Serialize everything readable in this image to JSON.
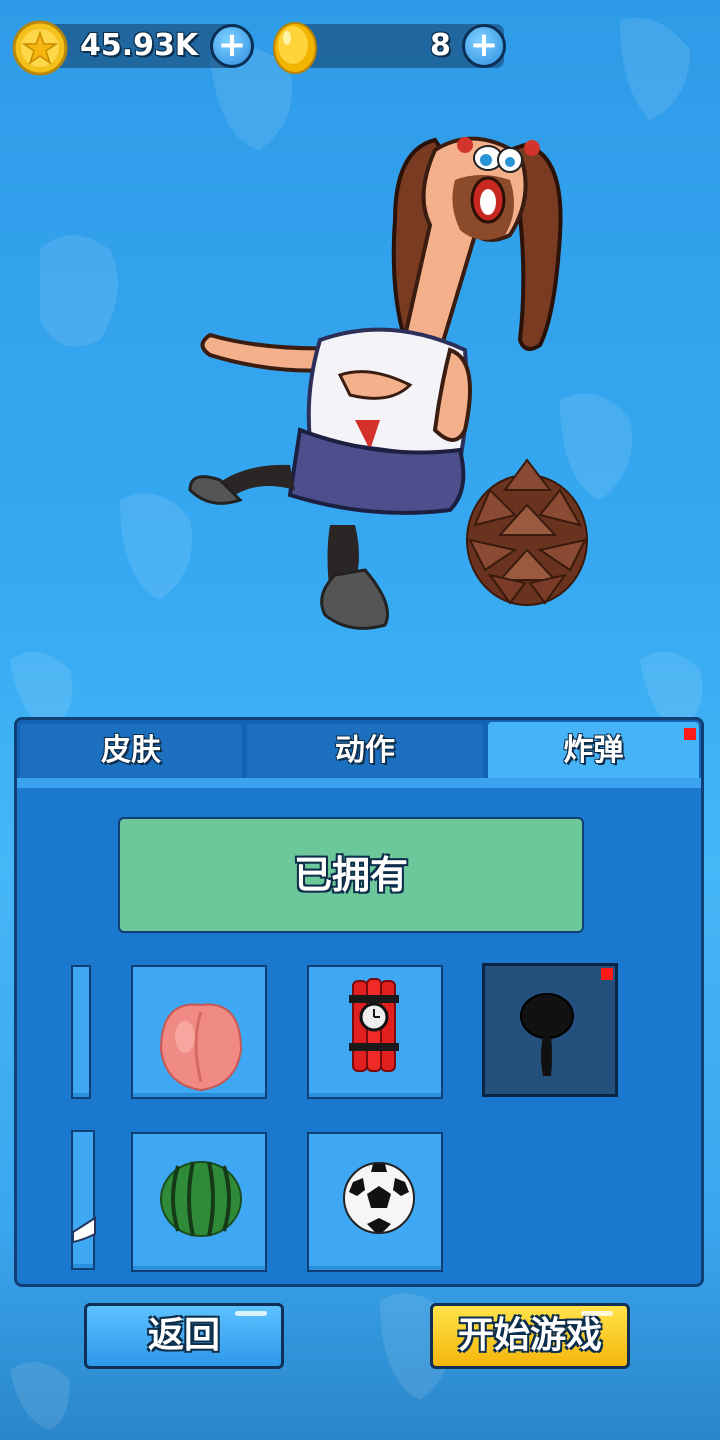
{
  "currency": {
    "stars": "45.93K",
    "coins": "8",
    "star_icon": "star-coin-icon",
    "coin_icon": "gold-egg-icon",
    "add_icon": "plus-icon"
  },
  "tabs": [
    {
      "label": "皮肤",
      "active": false
    },
    {
      "label": "动作",
      "active": false
    },
    {
      "label": "炸弹",
      "active": true,
      "badge": true
    }
  ],
  "owned_label": "已拥有",
  "items": [
    {
      "name": "peach",
      "icon": "peach-icon",
      "selected": false
    },
    {
      "name": "dynamite",
      "icon": "dynamite-icon",
      "selected": false
    },
    {
      "name": "frying-pan",
      "icon": "frying-pan-icon",
      "selected": true,
      "badge": true
    },
    {
      "name": "watermelon",
      "icon": "watermelon-icon",
      "selected": false
    },
    {
      "name": "soccer-ball",
      "icon": "soccer-ball-icon",
      "selected": false
    }
  ],
  "buttons": {
    "back": "返回",
    "start": "开始游戏"
  },
  "colors": {
    "panel": "#1a78cf",
    "active_tab": "#47b3f7",
    "owned": "#6cc79b",
    "start_button": "#f5b60c",
    "badge": "#ff1a1a"
  }
}
